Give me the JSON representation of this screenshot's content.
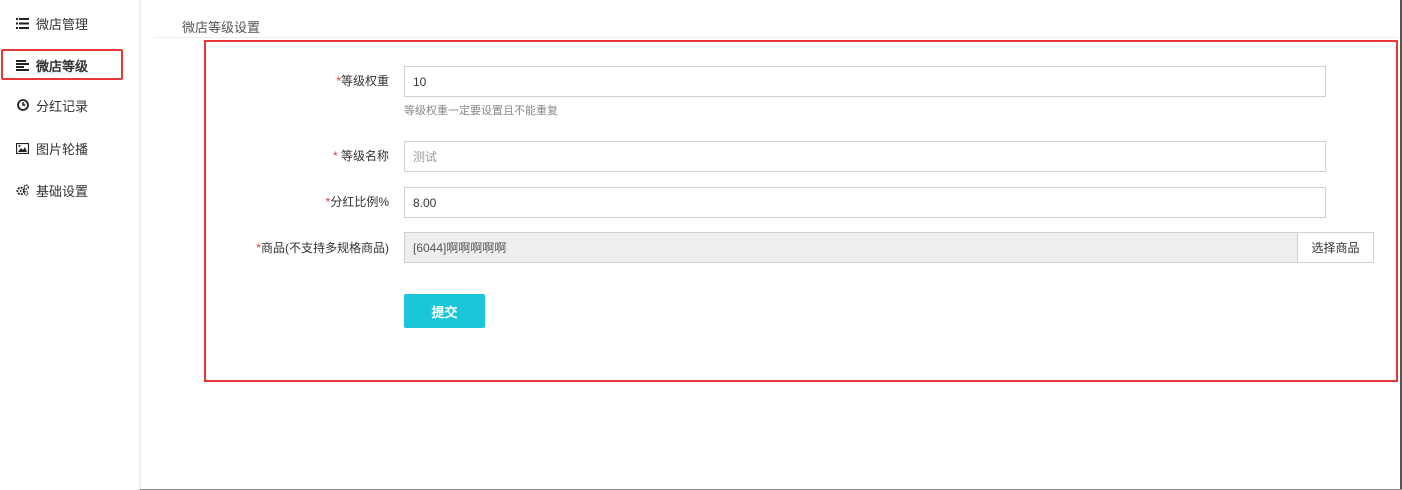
{
  "sidebar": {
    "items": [
      {
        "label": "微店管理",
        "icon": "list-icon"
      },
      {
        "label": "微店等级",
        "icon": "align-left-icon"
      },
      {
        "label": "分红记录",
        "icon": "clock-icon"
      },
      {
        "label": "图片轮播",
        "icon": "image-icon"
      },
      {
        "label": "基础设置",
        "icon": "gears-icon"
      }
    ]
  },
  "page": {
    "title": "微店等级设置"
  },
  "form": {
    "weight": {
      "required": "*",
      "label": "等级权重",
      "value": "10",
      "help": "等级权重一定要设置且不能重复"
    },
    "name": {
      "required": "* ",
      "label": "等级名称",
      "placeholder": "测试"
    },
    "ratio": {
      "required": "*",
      "label": "分红比例%",
      "value": "8.00"
    },
    "product": {
      "required": "*",
      "label": "商品(不支持多规格商品)",
      "value": "[6044]啊啊啊啊啊",
      "select_label": "选择商品"
    },
    "submit_label": "提交"
  },
  "colors": {
    "accent": "#1ac6d8",
    "highlight": "#e53935"
  }
}
